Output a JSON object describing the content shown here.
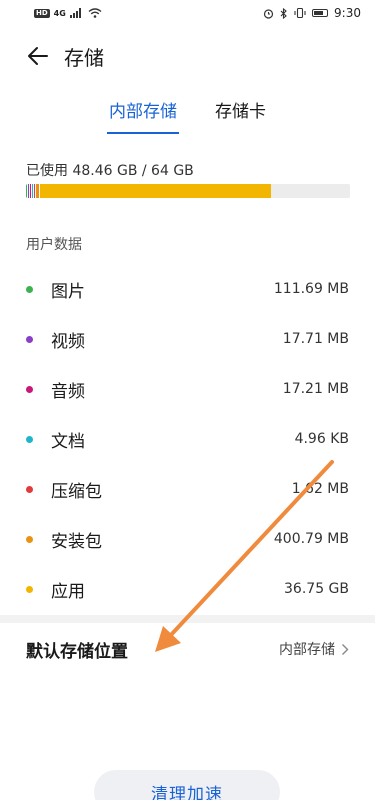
{
  "status_bar": {
    "left": {
      "hd": "HD",
      "network": "4G"
    },
    "right": {
      "time": "9:30"
    }
  },
  "header": {
    "back_icon": "arrow-left-icon",
    "title": "存储"
  },
  "tabs": [
    {
      "label": "内部存储",
      "active": true
    },
    {
      "label": "存储卡",
      "active": false
    }
  ],
  "usage": {
    "text": "已使用 48.46 GB / 64 GB",
    "used_fraction": 0.757,
    "segments": [
      {
        "color": "#3db24e",
        "fraction": 0.006
      },
      {
        "color": "#8a3fc8",
        "fraction": 0.006
      },
      {
        "color": "#c8197a",
        "fraction": 0.006
      },
      {
        "color": "#1eb6c8",
        "fraction": 0.006
      },
      {
        "color": "#e23b3b",
        "fraction": 0.006
      },
      {
        "color": "#e89412",
        "fraction": 0.012
      },
      {
        "color": "#f2b600",
        "fraction": 0.715
      }
    ]
  },
  "section_label": "用户数据",
  "items": [
    {
      "label": "图片",
      "value": "111.69 MB",
      "color": "#3db24e"
    },
    {
      "label": "视频",
      "value": "17.71 MB",
      "color": "#8a3fc8"
    },
    {
      "label": "音频",
      "value": "17.21 MB",
      "color": "#c8197a"
    },
    {
      "label": "文档",
      "value": "4.96 KB",
      "color": "#1eb6c8"
    },
    {
      "label": "压缩包",
      "value": "1.62 MB",
      "color": "#e23b3b"
    },
    {
      "label": "安装包",
      "value": "400.79 MB",
      "color": "#e89412"
    },
    {
      "label": "应用",
      "value": "36.75 GB",
      "color": "#f2b600"
    }
  ],
  "default_location": {
    "label": "默认存储位置",
    "value": "内部存储"
  },
  "clean_button": "清理加速",
  "annotation_color": "#f08a3c"
}
